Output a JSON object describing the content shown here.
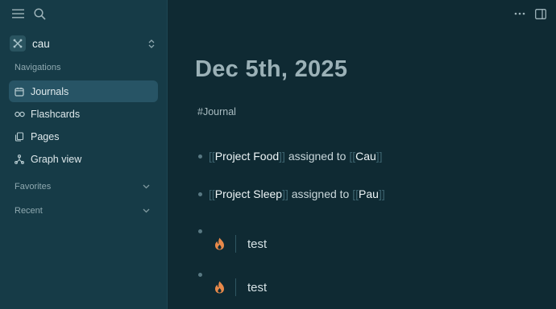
{
  "sidebar": {
    "graph_name": "cau",
    "navigations_label": "Navigations",
    "nav_items": [
      {
        "label": "Journals",
        "icon": "calendar-icon",
        "active": true
      },
      {
        "label": "Flashcards",
        "icon": "infinity-icon",
        "active": false
      },
      {
        "label": "Pages",
        "icon": "pages-icon",
        "active": false
      },
      {
        "label": "Graph view",
        "icon": "graph-icon",
        "active": false
      }
    ],
    "favorites_label": "Favorites",
    "recent_label": "Recent"
  },
  "page": {
    "title": "Dec 5th, 2025",
    "tag": "#Journal",
    "blocks": [
      {
        "open": "[[",
        "ref": "Project Food",
        "close": "]]",
        "middle": " assigned to ",
        "open2": "[[",
        "ref2": "Cau",
        "close2": "]]"
      },
      {
        "open": "[[",
        "ref": "Project Sleep",
        "close": "]]",
        "middle": " assigned to ",
        "open2": "[[",
        "ref2": "Pau",
        "close2": "]]"
      }
    ],
    "tasks": [
      {
        "icon": "fire-icon",
        "text": "test"
      },
      {
        "icon": "fire-icon",
        "text": "test"
      }
    ]
  },
  "colors": {
    "main_bg": "#0f2a33",
    "sidebar_bg": "#163b47",
    "active_nav": "#275465",
    "fire": "#e8894a"
  }
}
